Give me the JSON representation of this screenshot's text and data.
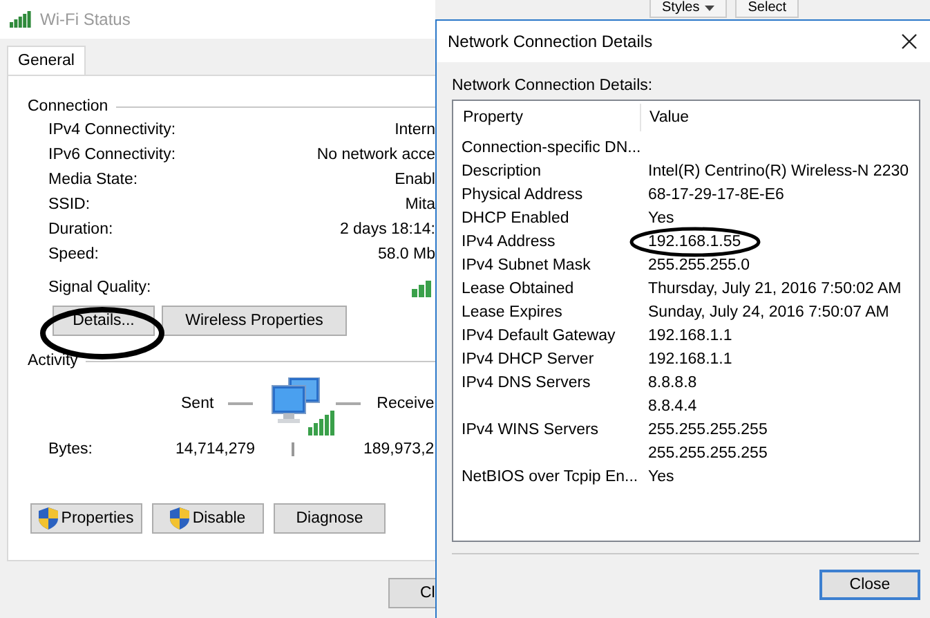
{
  "background_app": {
    "toolbar": [
      {
        "label": "Styles",
        "dropdown": true
      },
      {
        "label": "Select",
        "dropdown": false
      }
    ]
  },
  "wifi_status": {
    "title": "Wi-Fi Status",
    "active": false,
    "tabs": [
      {
        "label": "General",
        "selected": true
      }
    ],
    "connection": {
      "heading": "Connection",
      "rows": [
        {
          "label": "IPv4 Connectivity:",
          "value": "Intern"
        },
        {
          "label": "IPv6 Connectivity:",
          "value": "No network acce"
        },
        {
          "label": "Media State:",
          "value": "Enabl"
        },
        {
          "label": "SSID:",
          "value": "Mita"
        },
        {
          "label": "Duration:",
          "value": "2 days 18:14:"
        },
        {
          "label": "Speed:",
          "value": "58.0 Mb"
        }
      ],
      "signal_label": "Signal Quality:"
    },
    "buttons": [
      {
        "label": "Details..."
      },
      {
        "label": "Wireless Properties"
      }
    ],
    "activity": {
      "heading": "Activity",
      "sent_label": "Sent",
      "received_label": "Receive",
      "bytes_label": "Bytes:",
      "sent": "14,714,279",
      "received": "189,973,2"
    },
    "action_buttons": [
      {
        "label": "Properties",
        "shield": true
      },
      {
        "label": "Disable",
        "shield": true
      },
      {
        "label": "Diagnose",
        "shield": false
      }
    ],
    "close_button": "Cl"
  },
  "details": {
    "title": "Network Connection Details",
    "active": true,
    "caption": "Network Connection Details:",
    "columns": [
      "Property",
      "Value"
    ],
    "rows": [
      {
        "property": "Connection-specific DN...",
        "value": ""
      },
      {
        "property": "Description",
        "value": "Intel(R) Centrino(R) Wireless-N 2230"
      },
      {
        "property": "Physical Address",
        "value": "68-17-29-17-8E-E6"
      },
      {
        "property": "DHCP Enabled",
        "value": "Yes"
      },
      {
        "property": "IPv4 Address",
        "value": "192.168.1.55"
      },
      {
        "property": "IPv4 Subnet Mask",
        "value": "255.255.255.0"
      },
      {
        "property": "Lease Obtained",
        "value": "Thursday, July 21, 2016 7:50:02 AM"
      },
      {
        "property": "Lease Expires",
        "value": "Sunday, July 24, 2016 7:50:07 AM"
      },
      {
        "property": "IPv4 Default Gateway",
        "value": "192.168.1.1"
      },
      {
        "property": "IPv4 DHCP Server",
        "value": "192.168.1.1"
      },
      {
        "property": "IPv4 DNS Servers",
        "value": "8.8.8.8"
      },
      {
        "property": "",
        "value": "8.8.4.4"
      },
      {
        "property": "IPv4 WINS Servers",
        "value": "255.255.255.255"
      },
      {
        "property": "",
        "value": "255.255.255.255"
      },
      {
        "property": "NetBIOS over Tcpip En...",
        "value": "Yes"
      }
    ],
    "close_button": "Close"
  }
}
